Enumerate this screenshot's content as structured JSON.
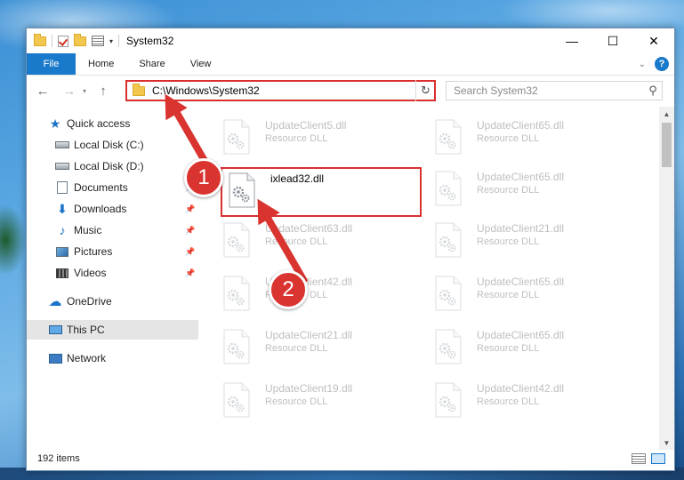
{
  "window": {
    "title": "System32",
    "controls": {
      "minimize": "—",
      "maximize": "☐",
      "close": "✕"
    }
  },
  "ribbon": {
    "tabs": [
      "File",
      "Home",
      "Share",
      "View"
    ]
  },
  "address": {
    "path": "C:\\Windows\\System32",
    "search_placeholder": "Search System32"
  },
  "nav": {
    "items": [
      {
        "label": "Quick access",
        "icon": "star-icon"
      },
      {
        "label": "Local Disk (C:)",
        "icon": "disk-icon"
      },
      {
        "label": "Local Disk (D:)",
        "icon": "disk-icon"
      },
      {
        "label": "Documents",
        "icon": "documents-icon",
        "pinned": true
      },
      {
        "label": "Downloads",
        "icon": "downloads-icon",
        "pinned": true
      },
      {
        "label": "Music",
        "icon": "music-icon",
        "pinned": true
      },
      {
        "label": "Pictures",
        "icon": "pictures-icon",
        "pinned": true
      },
      {
        "label": "Videos",
        "icon": "videos-icon",
        "pinned": true
      },
      {
        "label": "OneDrive",
        "icon": "onedrive-icon"
      },
      {
        "label": "This PC",
        "icon": "this-pc-icon",
        "selected": true
      },
      {
        "label": "Network",
        "icon": "network-icon"
      }
    ]
  },
  "files": [
    {
      "name": "UpdateClient5.dll",
      "type": "Resource DLL"
    },
    {
      "name": "UpdateClient65.dll",
      "type": "Resource DLL"
    },
    {
      "name": "ixlead32.dll",
      "type": ""
    },
    {
      "name": "UpdateClient65.dll",
      "type": "Resource DLL"
    },
    {
      "name": "UpdateClient63.dll",
      "type": "Resource DLL"
    },
    {
      "name": "UpdateClient21.dll",
      "type": "Resource DLL"
    },
    {
      "name": "UpdateClient42.dll",
      "type": "Resource DLL"
    },
    {
      "name": "UpdateClient65.dll",
      "type": "Resource DLL"
    },
    {
      "name": "UpdateClient21.dll",
      "type": "Resource DLL"
    },
    {
      "name": "UpdateClient65.dll",
      "type": "Resource DLL"
    },
    {
      "name": "UpdateClient19.dll",
      "type": "Resource DLL"
    },
    {
      "name": "UpdateClient42.dll",
      "type": "Resource DLL"
    }
  ],
  "status": {
    "item_count": "192 items"
  },
  "callouts": {
    "step1": "1",
    "step2": "2"
  },
  "colors": {
    "accent": "#1979ca",
    "callout": "#d9342f"
  }
}
